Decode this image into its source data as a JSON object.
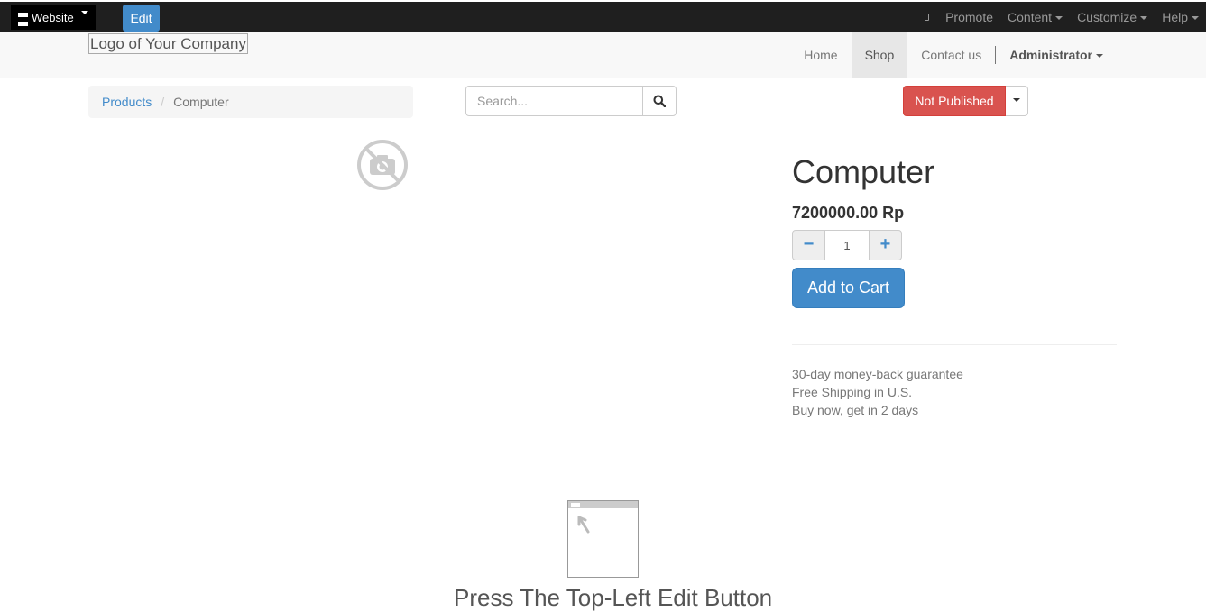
{
  "adminbar": {
    "website_label": "Website",
    "edit_label": "Edit",
    "right_items": [
      "Promote",
      "Content",
      "Customize",
      "Help"
    ]
  },
  "navbar": {
    "logo_alt": "Logo of Your Company",
    "items": [
      "Home",
      "Shop",
      "Contact us"
    ],
    "active": "Shop",
    "user": "Administrator"
  },
  "breadcrumb": {
    "parent": "Products",
    "current": "Computer"
  },
  "search": {
    "placeholder": "Search..."
  },
  "publish": {
    "label": "Not Published",
    "color": "#d9534f"
  },
  "product": {
    "name": "Computer",
    "price": "7200000.00 Rp",
    "quantity": "1",
    "minus_label": "−",
    "plus_label": "+",
    "add_to_cart": "Add to Cart",
    "features": [
      "30-day money-back guarantee",
      "Free Shipping in U.S.",
      "Buy now, get in 2 days"
    ]
  },
  "footer_hint": {
    "text": "Press The Top-Left Edit Button"
  },
  "colors": {
    "primary": "#428bca",
    "danger": "#d9534f",
    "adminbar": "#1f1f1f"
  }
}
